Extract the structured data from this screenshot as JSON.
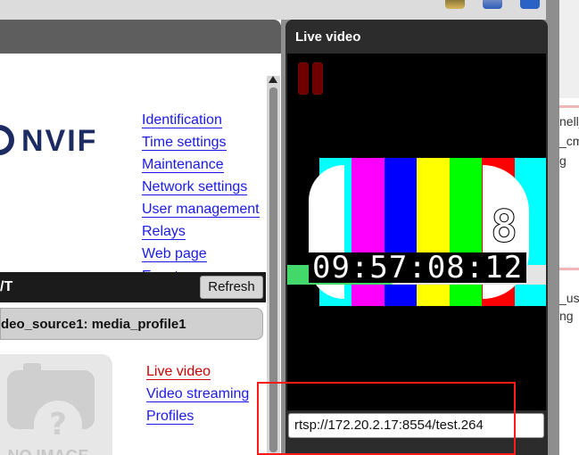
{
  "toolbar_icons": [
    "settings-icon",
    "tools-icon",
    "book-icon"
  ],
  "logo_text": "NVIF",
  "nav": [
    "Identification",
    "Time settings",
    "Maintenance",
    "Network settings",
    "User management",
    "Relays",
    "Web page",
    "Events"
  ],
  "section": {
    "title": "/T",
    "refresh_label": "Refresh"
  },
  "profile": {
    "label": "deo_source1: media_profile1"
  },
  "placeholder": {
    "text": "NO IMAGE"
  },
  "media_links": [
    {
      "label": "Live video",
      "active": true
    },
    {
      "label": "Video streaming",
      "active": false
    },
    {
      "label": "Profiles",
      "active": false
    }
  ],
  "video": {
    "title": "Live video",
    "counter": "8",
    "timecode": "09:57:08:12",
    "stream_url": "rtsp://172.20.2.17:8554/test.264"
  },
  "background_window": {
    "fragments": [
      "nell_",
      "_cm",
      "g",
      "_usa",
      "ng"
    ]
  },
  "colors": {
    "test_bars": [
      "#00ffff",
      "#ff00ff",
      "#0000ff",
      "#ffff00",
      "#00ff00",
      "#ff0000",
      "#00ffff"
    ],
    "link": "#1a1ae6",
    "link_active": "#cc0000",
    "highlight": "#ff1a1a"
  }
}
